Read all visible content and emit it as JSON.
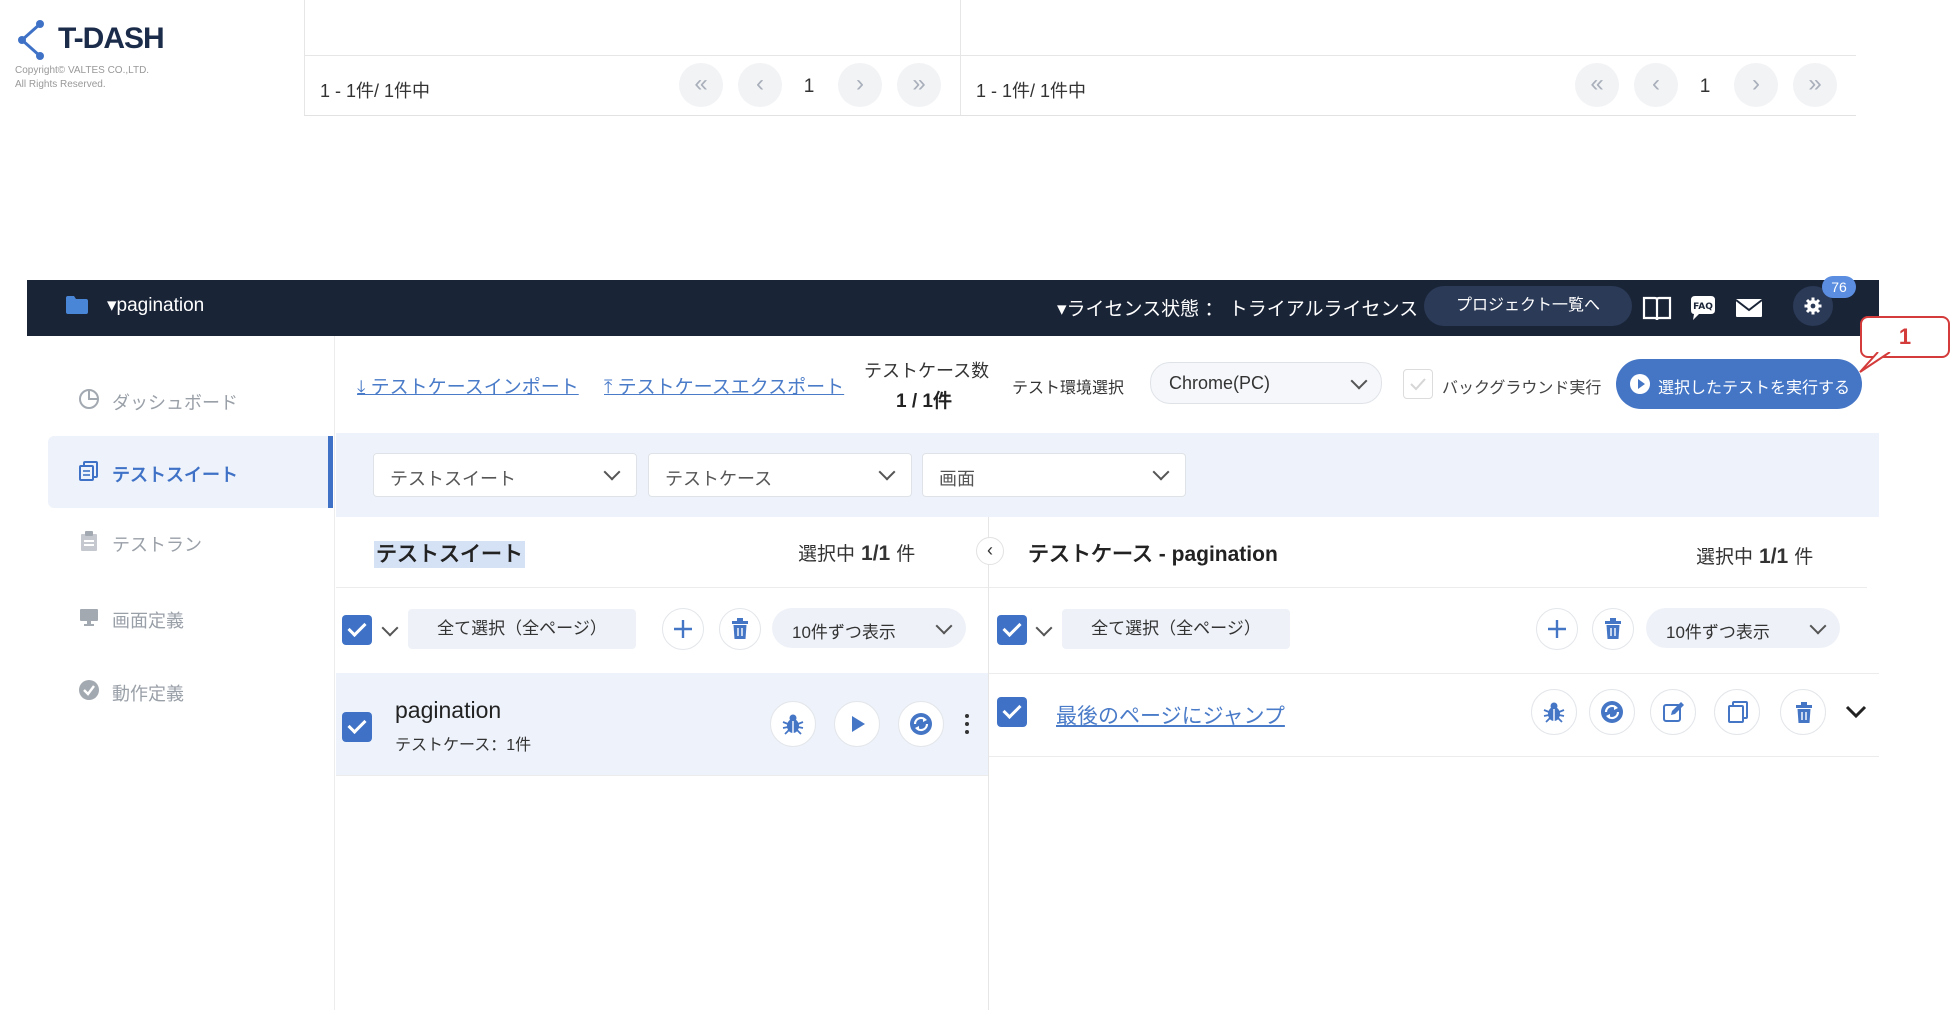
{
  "brand": {
    "name": "T-DASH",
    "copyright_line1": "Copyright© VALTES CO.,LTD.",
    "copyright_line2": "All Rights Reserved."
  },
  "prev_pagers": [
    {
      "count": "1 - 1件/ 1件中",
      "page": "1"
    },
    {
      "count": "1 - 1件/ 1件中",
      "page": "1"
    }
  ],
  "header": {
    "project": "▾pagination",
    "license": "▾ライセンス状態 ： トライアルライセンス",
    "project_list_button": "プロジェクト一覧へ",
    "badge": "76"
  },
  "sidebar": {
    "items": [
      {
        "label": "ダッシュボード",
        "icon": "pie-chart-icon"
      },
      {
        "label": "テストスイート",
        "icon": "copy-icon"
      },
      {
        "label": "テストラン",
        "icon": "clipboard-icon"
      },
      {
        "label": "画面定義",
        "icon": "monitor-icon"
      },
      {
        "label": "動作定義",
        "icon": "check-circle-icon"
      }
    ]
  },
  "toolbar": {
    "import_link": "⤓ テストケースインポート",
    "export_link": "⤒ テストケースエクスポート",
    "testcase_count_label": "テストケース数",
    "testcase_count_value": "1 / 1件",
    "env_label": "テスト環境選択",
    "env_value": "Chrome(PC)",
    "background_label": "バックグラウンド実行",
    "run_button": "選択したテストを実行する"
  },
  "callout": {
    "number": "1"
  },
  "filters": {
    "suite": "テストスイート",
    "case": "テストケース",
    "screen": "画面"
  },
  "suite_panel": {
    "title": "テストスイート",
    "selected_label": "選択中",
    "selected_value": "1/1",
    "selected_unit": "件",
    "select_all": "全て選択（全ページ）",
    "per_page": "10件ずつ表示",
    "rows": [
      {
        "name": "pagination",
        "sub": "テストケース：1件"
      }
    ]
  },
  "case_panel": {
    "title": "テストケース - pagination",
    "selected_label": "選択中",
    "selected_value": "1/1",
    "selected_unit": "件",
    "select_all": "全て選択（全ページ）",
    "per_page": "10件ずつ表示",
    "rows": [
      {
        "name": "最後のページにジャンプ"
      }
    ]
  },
  "colors": {
    "header_bg": "#1a2437",
    "accent": "#4576c6",
    "active_bg": "#eef3fb",
    "callout": "#d43b3b"
  }
}
